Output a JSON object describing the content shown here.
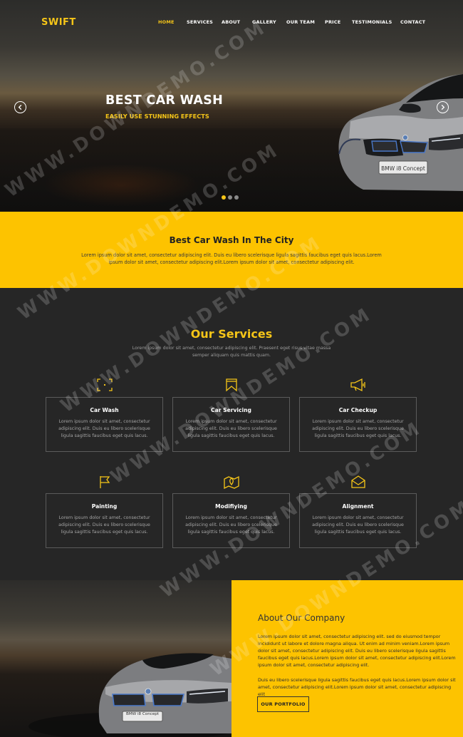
{
  "brand": {
    "logo": "SWIFT",
    "accent": "#fdc300",
    "dark": "#262626"
  },
  "nav": {
    "items": [
      {
        "label": "HOME",
        "active": true
      },
      {
        "label": "SERVICES"
      },
      {
        "label": "ABOUT"
      },
      {
        "label": "GALLERY"
      },
      {
        "label": "OUR TEAM"
      },
      {
        "label": "PRICE"
      },
      {
        "label": "TESTIMONIALS"
      },
      {
        "label": "CONTACT"
      }
    ]
  },
  "hero": {
    "title": "BEST CAR WASH",
    "subtitle": "EASILY USE STUNNING EFFECTS",
    "prev_icon": "chevron-left-icon",
    "next_icon": "chevron-right-icon",
    "slide_count": 3,
    "active_slide": 1,
    "car_plate": "BMW i8 Concept"
  },
  "banner": {
    "title": "Best Car Wash In The City",
    "text": "Lorem ipsum dolor sit amet, consectetur adipiscing elit. Duis eu libero scelerisque ligula sagittis faucibus eget quis lacus.Lorem ipsum dolor sit amet, consectetur adipiscing elit.Lorem ipsum dolor sit amet, consectetur adipiscing elit."
  },
  "services": {
    "title": "Our Services",
    "intro": "Lorem ipsum dolor sit amet, consectetur adipiscing elit. Praesent eget risus vitae massa semper aliquam quis mattis quam.",
    "items": [
      {
        "title": "Car Wash",
        "icon": "focus-frame-icon",
        "text": "Lorem ipsum dolor sit amet, consectetur adipiscing elit. Duis eu libero scelerisque ligula sagittis faucibus eget quis lacus."
      },
      {
        "title": "Car Servicing",
        "icon": "bookmark-icon",
        "text": "Lorem ipsum dolor sit amet, consectetur adipiscing elit. Duis eu libero scelerisque ligula sagittis faucibus eget quis lacus."
      },
      {
        "title": "Car Checkup",
        "icon": "megaphone-icon",
        "text": "Lorem ipsum dolor sit amet, consectetur adipiscing elit. Duis eu libero scelerisque ligula sagittis faucibus eget quis lacus."
      },
      {
        "title": "Painting",
        "icon": "flag-icon",
        "text": "Lorem ipsum dolor sit amet, consectetur adipiscing elit. Duis eu libero scelerisque ligula sagittis faucibus eget quis lacus."
      },
      {
        "title": "Modifiying",
        "icon": "map-pin-icon",
        "text": "Lorem ipsum dolor sit amet, consectetur adipiscing elit. Duis eu libero scelerisque ligula sagittis faucibus eget quis lacus."
      },
      {
        "title": "Alignment",
        "icon": "envelope-icon",
        "text": "Lorem ipsum dolor sit amet, consectetur adipiscing elit. Duis eu libero scelerisque ligula sagittis faucibus eget quis lacus."
      }
    ]
  },
  "about": {
    "title": "About Our Company",
    "para1": "Lorem ipsum dolor sit amet, consectetur adipiscing elit. sed do eiusmod tempor incididunt ut labore et dolore magna aliqua. Ut enim ad minim veniam.Lorem ipsum dolor sit amet, consectetur adipiscing elit. Duis eu libero scelerisque ligula sagittis faucibus eget quis lacus.Lorem ipsum dolor sit amet, consectetur adipiscing elit.Lorem ipsum dolor sit amet, consectetur adipiscing elit.",
    "para2": "Duis eu libero scelerisque ligula sagittis faucibus eget quis lacus.Lorem ipsum dolor sit amet, consectetur adipiscing elit.Lorem ipsum dolor sit amet, consectetur adipiscing elit",
    "button": "OUR PORTFOLIO"
  },
  "watermark": "WWW.DOWNDEMO.COM"
}
